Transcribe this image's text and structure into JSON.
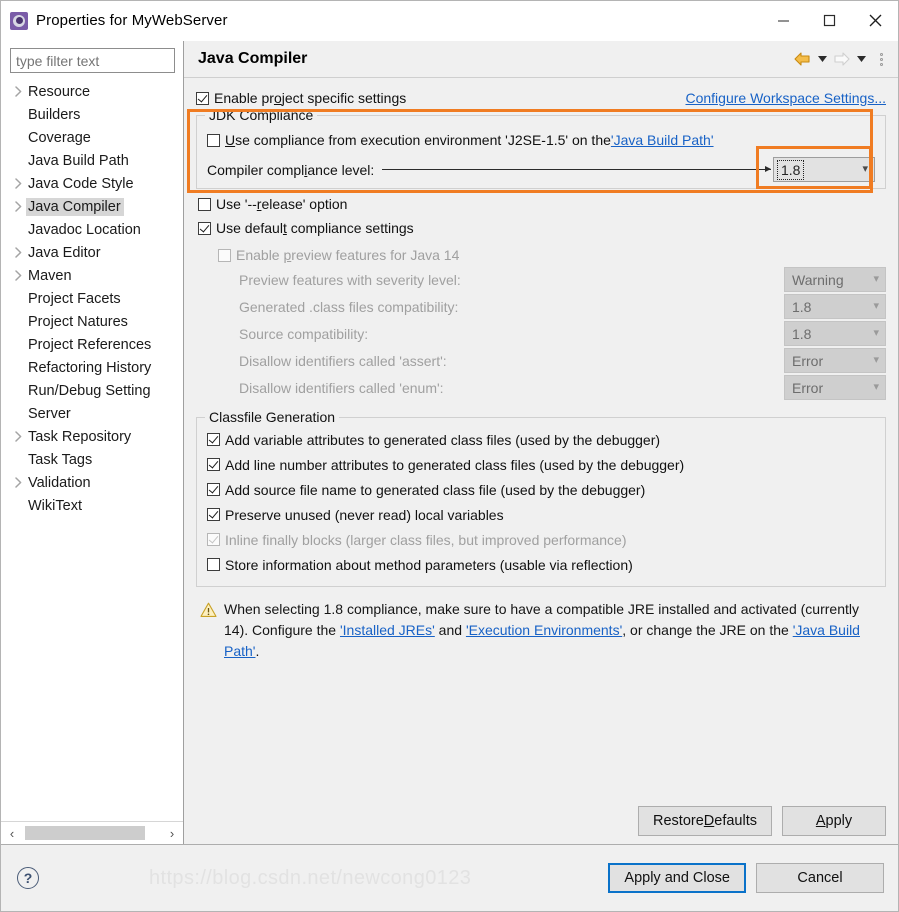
{
  "window": {
    "title": "Properties for MyWebServer",
    "minimize_label": "Minimize",
    "maximize_label": "Maximize",
    "close_label": "Close"
  },
  "sidebar": {
    "filter_placeholder": "type filter text",
    "filter_value": "",
    "items": [
      {
        "label": "Resource",
        "expandable": true,
        "selected": false
      },
      {
        "label": "Builders",
        "expandable": false,
        "selected": false
      },
      {
        "label": "Coverage",
        "expandable": false,
        "selected": false
      },
      {
        "label": "Java Build Path",
        "expandable": false,
        "selected": false
      },
      {
        "label": "Java Code Style",
        "expandable": true,
        "selected": false
      },
      {
        "label": "Java Compiler",
        "expandable": true,
        "selected": true
      },
      {
        "label": "Javadoc Location",
        "expandable": false,
        "selected": false
      },
      {
        "label": "Java Editor",
        "expandable": true,
        "selected": false
      },
      {
        "label": "Maven",
        "expandable": true,
        "selected": false
      },
      {
        "label": "Project Facets",
        "expandable": false,
        "selected": false
      },
      {
        "label": "Project Natures",
        "expandable": false,
        "selected": false
      },
      {
        "label": "Project References",
        "expandable": false,
        "selected": false
      },
      {
        "label": "Refactoring History",
        "expandable": false,
        "selected": false
      },
      {
        "label": "Run/Debug Setting",
        "expandable": false,
        "selected": false
      },
      {
        "label": "Server",
        "expandable": false,
        "selected": false
      },
      {
        "label": "Task Repository",
        "expandable": true,
        "selected": false
      },
      {
        "label": "Task Tags",
        "expandable": false,
        "selected": false
      },
      {
        "label": "Validation",
        "expandable": true,
        "selected": false
      },
      {
        "label": "WikiText",
        "expandable": false,
        "selected": false
      }
    ],
    "scroll_left_label": "‹",
    "scroll_right_label": "›"
  },
  "page": {
    "title": "Java Compiler",
    "enable_project_specific": {
      "label_pre": "Enable pr",
      "label_mnemonic": "o",
      "label_post": "ject specific settings",
      "checked": true
    },
    "configure_workspace_link": "Configure Workspace Settings..."
  },
  "jdk_compliance": {
    "group_title": "JDK Compliance",
    "use_execution_env": {
      "label_pre": "",
      "label_mnemonic": "U",
      "label_post": "se compliance from execution environment 'J2SE-1.5' on the ",
      "link": "'Java Build Path'",
      "checked": false
    },
    "compliance_level_label_pre": "Compiler compl",
    "compliance_level_mnemonic": "i",
    "compliance_level_label_post": "ance level:",
    "compliance_level_full": "Compiler compliance level:",
    "compliance_level_value": "1.8",
    "use_release_option": {
      "label_pre": "Use '--",
      "label_mnemonic": "r",
      "label_post": "elease' option",
      "checked": false
    },
    "use_default_compliance": {
      "label_pre": "Use defaul",
      "label_mnemonic": "t",
      "label_post": " compliance settings",
      "checked": true
    },
    "enable_preview": {
      "label_pre": "Enable ",
      "label_mnemonic": "p",
      "label_post": "review features for Java 14",
      "checked": false,
      "disabled": true
    },
    "sub_options": [
      {
        "label": "Preview features with severity level:",
        "value": "Warning",
        "disabled": true
      },
      {
        "label": "Generated .class files compatibility:",
        "value": "1.8",
        "disabled": true
      },
      {
        "label": "Source compatibility:",
        "value": "1.8",
        "disabled": true
      },
      {
        "label": "Disallow identifiers called 'assert':",
        "value": "Error",
        "disabled": true
      },
      {
        "label": "Disallow identifiers called 'enum':",
        "value": "Error",
        "disabled": true
      }
    ]
  },
  "classfile_generation": {
    "group_title": "Classfile Generation",
    "options": [
      {
        "label": "Add variable attributes to generated class files (used by the debugger)",
        "checked": true,
        "disabled": false
      },
      {
        "label": "Add line number attributes to generated class files (used by the debugger)",
        "checked": true,
        "disabled": false
      },
      {
        "label": "Add source file name to generated class file (used by the debugger)",
        "checked": true,
        "disabled": false
      },
      {
        "label": "Preserve unused (never read) local variables",
        "checked": true,
        "disabled": false
      },
      {
        "label": "Inline finally blocks (larger class files, but improved performance)",
        "checked": true,
        "disabled": true
      },
      {
        "label": "Store information about method parameters (usable via reflection)",
        "checked": false,
        "disabled": false
      }
    ]
  },
  "note": {
    "icon": "warning-icon",
    "text_1": "When selecting 1.8 compliance, make sure to have a compatible JRE installed and activated (currently 14). Configure the ",
    "link_1": "'Installed JREs'",
    "text_2": " and ",
    "link_2": "'Execution Environments'",
    "text_3": ", or change the JRE on the ",
    "link_3": "'Java Build Path'",
    "text_4": "."
  },
  "buttons": {
    "restore_defaults_pre": "Restore ",
    "restore_defaults_mnemonic": "D",
    "restore_defaults_post": "efaults",
    "apply_pre": "",
    "apply_mnemonic": "A",
    "apply_post": "pply",
    "apply_and_close": "Apply and Close",
    "cancel": "Cancel",
    "help": "?"
  },
  "watermark": "https://blog.csdn.net/newcong0123",
  "colors": {
    "annotation": "#f07c22",
    "link": "#1862c6",
    "default_button_border": "#0a72c9",
    "selection": "#d6d6d6"
  }
}
